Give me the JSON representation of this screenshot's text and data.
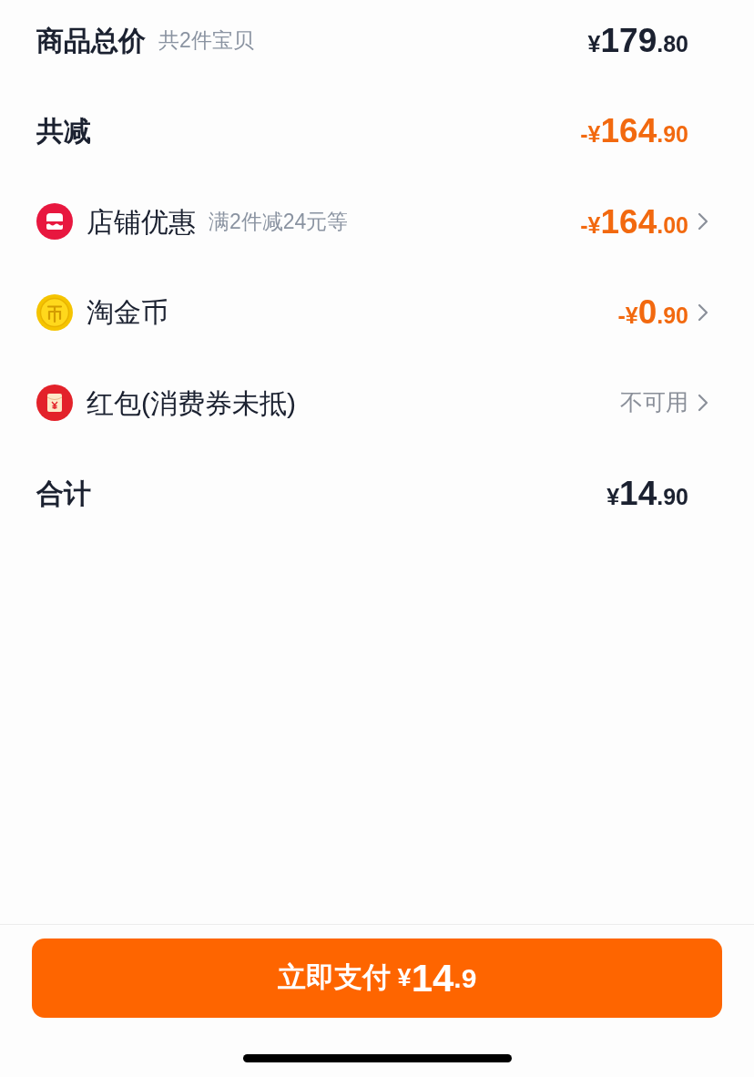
{
  "rows": [
    {
      "kind": "summary",
      "label": "商品总价",
      "note": "共2件宝贝",
      "amount": {
        "prefix": "¥",
        "integer": "179",
        "decimal": ".80"
      },
      "highlight": false,
      "chevron": false
    },
    {
      "kind": "summary",
      "label": "共减",
      "amount": {
        "prefix": "-¥",
        "integer": "164",
        "decimal": ".90"
      },
      "highlight": true,
      "chevron": false
    },
    {
      "kind": "shop_discount",
      "label": "店铺优惠",
      "note": "满2件减24元等",
      "amount": {
        "prefix": "-¥",
        "integer": "164",
        "decimal": ".00"
      },
      "highlight": true,
      "chevron": true
    },
    {
      "kind": "coin",
      "label": "淘金币",
      "amount": {
        "prefix": "-¥",
        "integer": "0",
        "decimal": ".90"
      },
      "highlight": true,
      "chevron": true
    },
    {
      "kind": "red_packet",
      "label": "红包(消费券未抵)",
      "status": "不可用",
      "chevron": true
    },
    {
      "kind": "summary",
      "label": "合计",
      "amount": {
        "prefix": "¥",
        "integer": "14",
        "decimal": ".90"
      },
      "highlight": false,
      "chevron": false
    }
  ],
  "pay_button": {
    "label": "立即支付",
    "amount": {
      "prefix": "¥",
      "integer": "14",
      "decimal": ".9"
    }
  }
}
